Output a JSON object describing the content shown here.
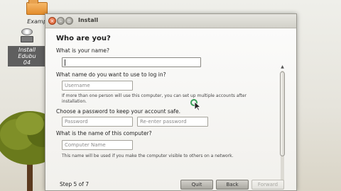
{
  "desktop": {
    "icons": [
      {
        "label": "Examp"
      },
      {
        "label_line1": "Install Edubu",
        "label_line2": "04"
      }
    ]
  },
  "window": {
    "title": "Install",
    "heading": "Who are you?",
    "questions": {
      "name_q": "What is your name?",
      "login_q": "What name do you want to use to log in?",
      "username_placeholder": "Username",
      "login_hint_line1": "If more than one person will use this computer, you can set up multiple accounts after",
      "login_hint_line2": "installation.",
      "password_q": "Choose a password to keep your account safe.",
      "password_placeholder": "Password",
      "reenter_placeholder": "Re-enter password",
      "computer_q": "What is the name of this computer?",
      "computer_placeholder": "Computer Name",
      "computer_hint": "This name will be used if you make the computer visible to others on a network."
    },
    "footer": {
      "step": "Step 5 of 7",
      "quit": "Quit",
      "back": "Back",
      "forward": "Forward"
    }
  },
  "colors": {
    "window_bg": "#f2f1ee",
    "close_button": "#d45424",
    "button_gray": "#a9a7a0"
  }
}
